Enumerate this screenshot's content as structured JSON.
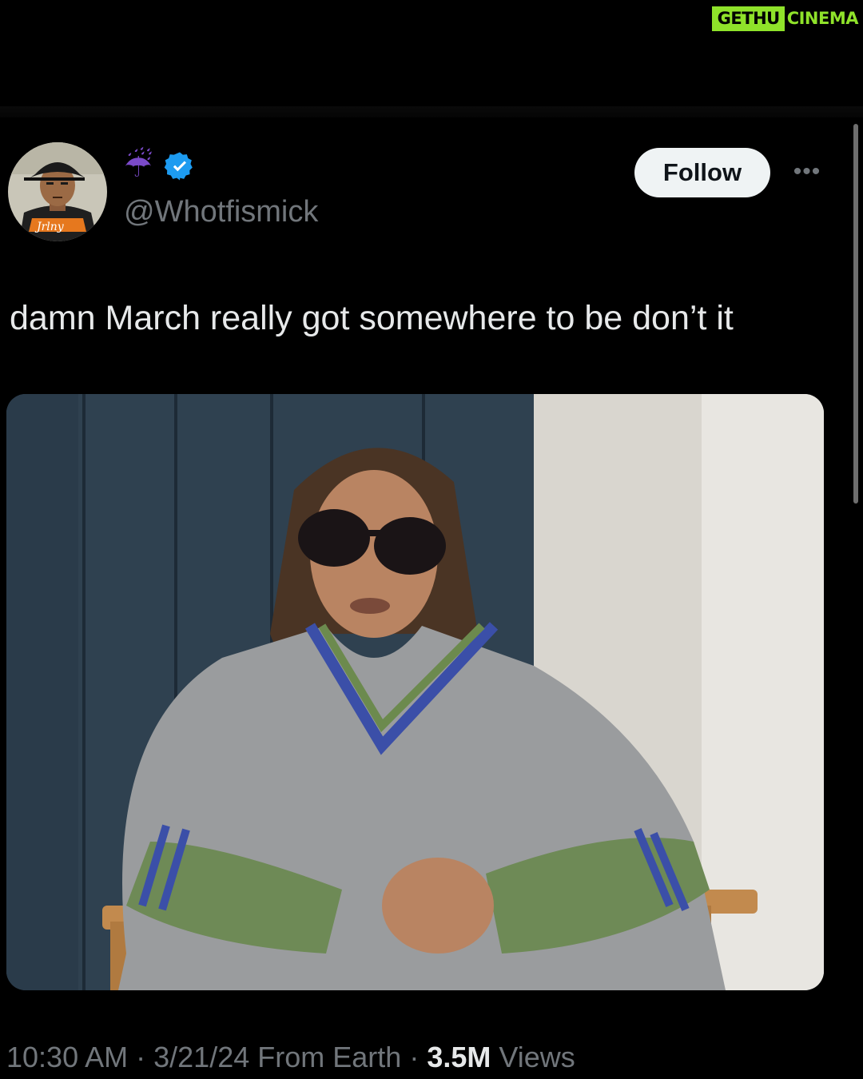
{
  "watermark": {
    "part1": "GETHU",
    "part2": "CINEMA"
  },
  "tweet": {
    "display_name_emoji": "☔",
    "handle": "@Whotfismick",
    "follow_label": "Follow",
    "more_label": "•••",
    "text": "damn March really got somewhere to be don’t it",
    "time": "10:30 AM",
    "date": "3/21/24",
    "source": "From Earth",
    "views_count": "3.5M",
    "views_label": "Views",
    "separator": "·"
  },
  "colors": {
    "background": "#000000",
    "text_primary": "#e7e9ea",
    "text_secondary": "#71767b",
    "verified_blue": "#1d9bf0",
    "follow_bg": "#eff3f4",
    "watermark_green": "#8fe22a"
  },
  "icons": {
    "verified": "verified-badge-icon",
    "more": "more-options-icon",
    "display_name": "umbrella-rain-emoji"
  }
}
